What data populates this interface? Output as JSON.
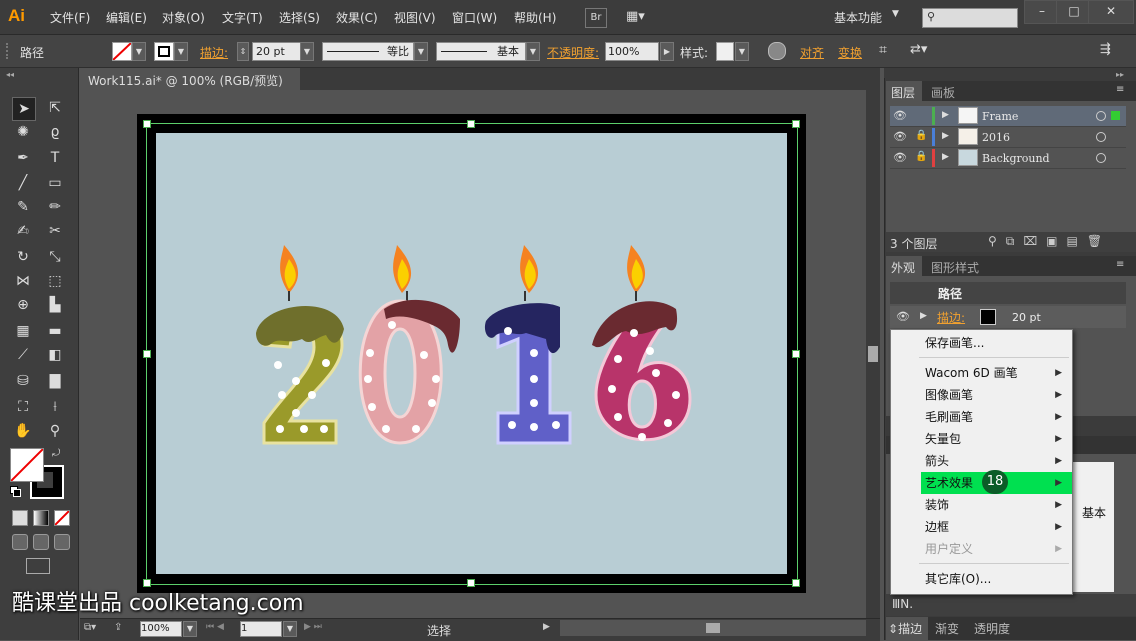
{
  "app": {
    "logo": "Ai",
    "workspace": "基本功能"
  },
  "menubar": {
    "items": [
      "文件(F)",
      "编辑(E)",
      "对象(O)",
      "文字(T)",
      "选择(S)",
      "效果(C)",
      "视图(V)",
      "窗口(W)",
      "帮助(H)"
    ],
    "bridge_label": "Br",
    "window_buttons": [
      "–",
      "□",
      "✕"
    ]
  },
  "control_bar": {
    "path_label": "路径",
    "stroke_label": "描边:",
    "stroke_value": "20 pt",
    "profile_label": "等比",
    "brush_label": "基本",
    "opacity_label": "不透明度:",
    "opacity_value": "100%",
    "style_label": "样式:",
    "align_label": "对齐",
    "transform_label": "变换"
  },
  "document": {
    "tab_title": "Work115.ai* @ 100% (RGB/预览)",
    "artwork_text": "2016"
  },
  "statusbar": {
    "zoom": "100%",
    "page": "1",
    "tool_status": "选择"
  },
  "layers_panel": {
    "tabs": [
      "图层",
      "画板"
    ],
    "layers": [
      {
        "name": "Frame",
        "color": "#4caf50",
        "selected": true,
        "locked": false
      },
      {
        "name": "2016",
        "color": "#4a7fd8",
        "selected": false,
        "locked": true
      },
      {
        "name": "Background",
        "color": "#e04040",
        "selected": false,
        "locked": true
      }
    ],
    "count_label": "3 个图层"
  },
  "appearance_panel": {
    "tabs": [
      "外观",
      "图形样式"
    ],
    "title": "路径",
    "stroke_label": "描边:",
    "stroke_value": "20 pt"
  },
  "context_menu": {
    "items": [
      {
        "label": "保存画笔...",
        "submenu": false,
        "state": "normal"
      },
      {
        "label": "Wacom 6D 画笔",
        "submenu": true,
        "state": "normal"
      },
      {
        "label": "图像画笔",
        "submenu": true,
        "state": "normal"
      },
      {
        "label": "毛刷画笔",
        "submenu": true,
        "state": "normal"
      },
      {
        "label": "矢量包",
        "submenu": true,
        "state": "normal"
      },
      {
        "label": "箭头",
        "submenu": true,
        "state": "normal"
      },
      {
        "label": "艺术效果",
        "submenu": true,
        "state": "highlighted"
      },
      {
        "label": "装饰",
        "submenu": true,
        "state": "normal"
      },
      {
        "label": "边框",
        "submenu": true,
        "state": "normal"
      },
      {
        "label": "用户定义",
        "submenu": true,
        "state": "disabled"
      },
      {
        "label": "其它库(O)...",
        "submenu": false,
        "state": "normal"
      }
    ],
    "step_badge": "18",
    "highlight_color": "#00e050"
  },
  "brushes_panel": {
    "basic_label": "基本"
  },
  "bottom_tabs": [
    "描边",
    "渐变",
    "透明度"
  ],
  "watermark": "酷课堂出品 coolketang.com"
}
